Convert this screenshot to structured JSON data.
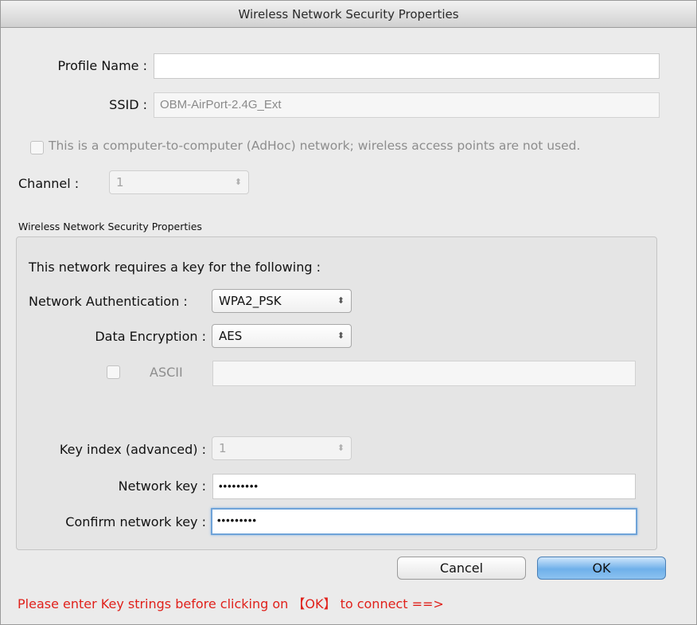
{
  "window": {
    "title": "Wireless Network Security Properties"
  },
  "profile": {
    "profile_name_label": "Profile Name :",
    "profile_name_value": "",
    "ssid_label": "SSID :",
    "ssid_value": "OBM-AirPort-2.4G_Ext",
    "adhoc_checkbox_label": "This is a computer-to-computer (AdHoc) network; wireless access points are not used.",
    "adhoc_checked": false,
    "channel_label": "Channel :",
    "channel_value": "1"
  },
  "security": {
    "group_title": "Wireless Network Security Properties",
    "requires_key_text": "This network requires a key for the following :",
    "auth_label": "Network Authentication :",
    "auth_value": "WPA2_PSK",
    "encryption_label": "Data Encryption :",
    "encryption_value": "AES",
    "ascii_label": "ASCII",
    "ascii_checked": false,
    "ascii_value": "",
    "key_index_label": "Key index (advanced) :",
    "key_index_value": "1",
    "network_key_label": "Network key :",
    "network_key_value": "•••••••••",
    "confirm_key_label": "Confirm network key :",
    "confirm_key_value": "•••••••••"
  },
  "buttons": {
    "cancel": "Cancel",
    "ok": "OK"
  },
  "status": {
    "message": "Please enter Key strings before clicking on 【OK】 to connect ==>",
    "message_color": "#e0211b"
  },
  "icons": {
    "select_arrows": "updown-chevron-icon"
  }
}
